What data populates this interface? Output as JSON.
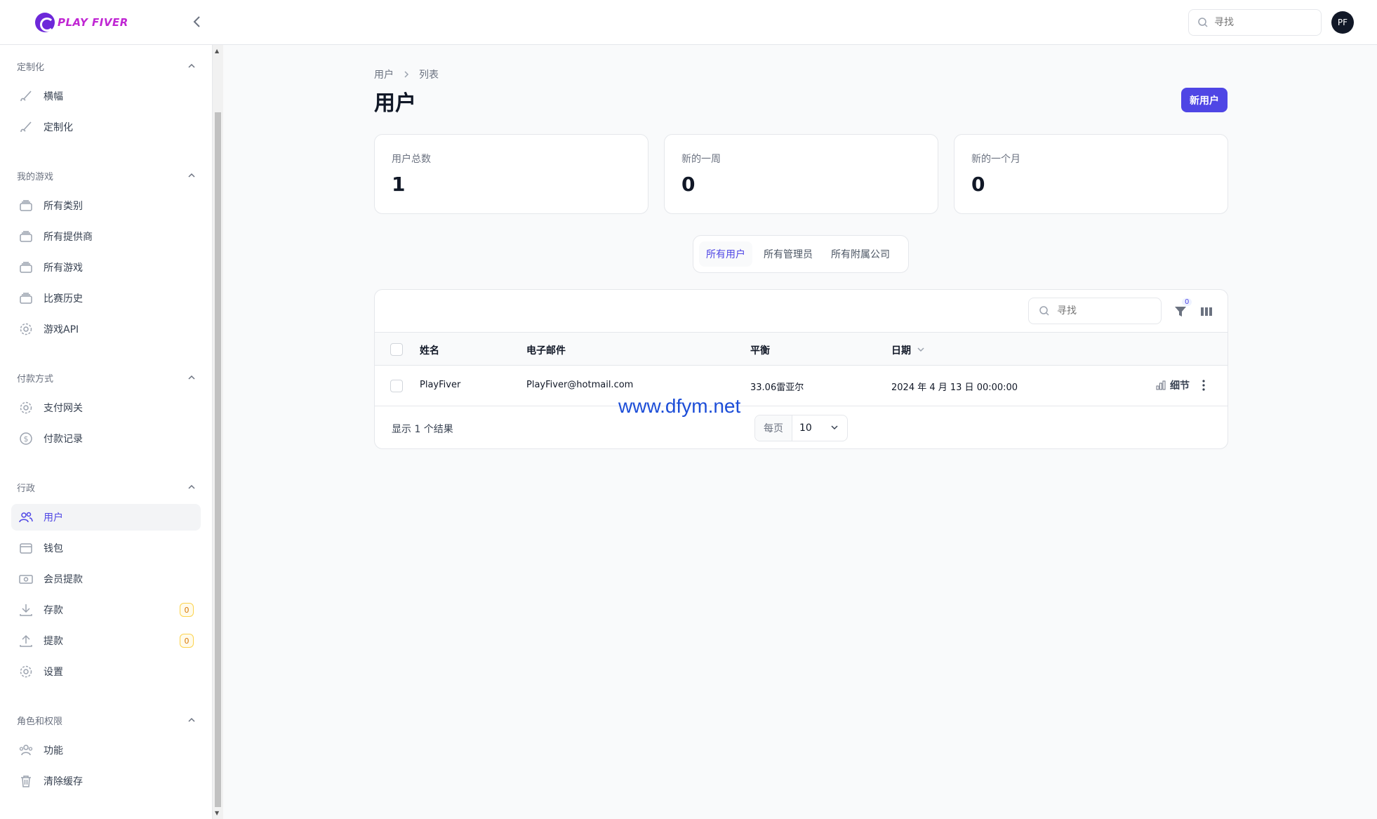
{
  "app": {
    "logo_text": "PLAY FIVER",
    "collapse_icon": "chevron-left-icon",
    "search_placeholder": "寻找",
    "avatar_initials": "PF"
  },
  "sidebar": {
    "groups": [
      {
        "title": "定制化",
        "items": [
          {
            "label": "横幅",
            "icon": "brush-icon"
          },
          {
            "label": "定制化",
            "icon": "brush-icon"
          }
        ]
      },
      {
        "title": "我的游戏",
        "items": [
          {
            "label": "所有类别",
            "icon": "stack-icon"
          },
          {
            "label": "所有提供商",
            "icon": "stack-icon"
          },
          {
            "label": "所有游戏",
            "icon": "stack-icon"
          },
          {
            "label": "比赛历史",
            "icon": "stack-icon"
          },
          {
            "label": "游戏API",
            "icon": "gear-icon"
          }
        ]
      },
      {
        "title": "付款方式",
        "items": [
          {
            "label": "支付网关",
            "icon": "gear-icon"
          },
          {
            "label": "付款记录",
            "icon": "dollar-icon"
          }
        ]
      },
      {
        "title": "行政",
        "items": [
          {
            "label": "用户",
            "icon": "users-icon",
            "active": true
          },
          {
            "label": "钱包",
            "icon": "wallet-icon"
          },
          {
            "label": "会员提款",
            "icon": "cash-icon"
          },
          {
            "label": "存款",
            "icon": "download-icon",
            "badge": "0"
          },
          {
            "label": "提款",
            "icon": "upload-icon",
            "badge": "0"
          },
          {
            "label": "设置",
            "icon": "gear-icon"
          }
        ]
      },
      {
        "title": "角色和权限",
        "items": [
          {
            "label": "功能",
            "icon": "user-group-icon"
          },
          {
            "label": "清除缓存",
            "icon": "trash-icon"
          }
        ]
      }
    ]
  },
  "breadcrumb": {
    "items": [
      "用户",
      "列表"
    ]
  },
  "page": {
    "title": "用户",
    "new_button": "新用户"
  },
  "stats": [
    {
      "label": "用户总数",
      "value": "1"
    },
    {
      "label": "新的一周",
      "value": "0"
    },
    {
      "label": "新的一个月",
      "value": "0"
    }
  ],
  "tabs": [
    {
      "label": "所有用户",
      "active": true
    },
    {
      "label": "所有管理员"
    },
    {
      "label": "所有附属公司"
    }
  ],
  "table": {
    "search_placeholder": "寻找",
    "filter_count": "0",
    "columns": [
      "姓名",
      "电子邮件",
      "平衡",
      "日期"
    ],
    "rows": [
      {
        "name": "PlayFiver",
        "email": "PlayFiver@hotmail.com",
        "balance": "33.06雷亚尔",
        "date": "2024 年 4 月 13 日 00:00:00",
        "action": "细节"
      }
    ],
    "results_text": "显示 1 个结果",
    "per_page_label": "每页",
    "per_page_value": "10",
    "per_page_options": [
      "10"
    ]
  },
  "watermark": "www.dfym.net",
  "colors": {
    "accent": "#4f46e5",
    "badge": "#d97706"
  }
}
